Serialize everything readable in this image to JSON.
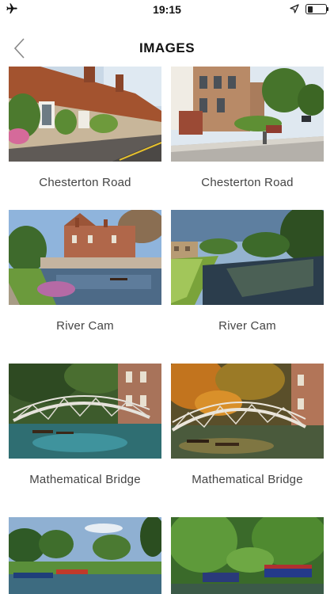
{
  "status_bar": {
    "time": "19:15",
    "battery_level": 0.3,
    "icons": [
      "airplane-icon",
      "location-arrow-icon",
      "battery-icon"
    ]
  },
  "nav": {
    "title": "IMAGES",
    "back_icon": "chevron-left-icon"
  },
  "images": [
    {
      "caption": "Chesterton Road"
    },
    {
      "caption": "Chesterton Road"
    },
    {
      "caption": "River Cam"
    },
    {
      "caption": "River Cam"
    },
    {
      "caption": "Mathematical Bridge"
    },
    {
      "caption": "Mathematical Bridge"
    },
    {
      "caption": ""
    },
    {
      "caption": ""
    }
  ]
}
